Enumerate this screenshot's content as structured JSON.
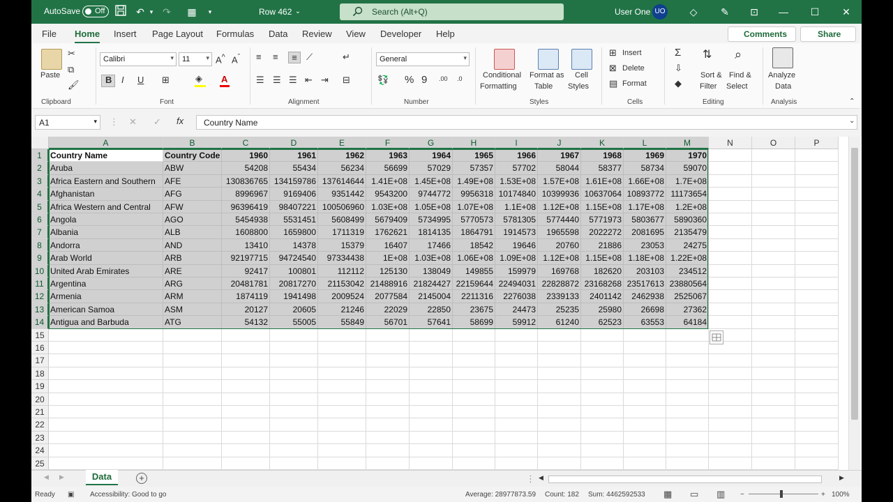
{
  "titlebar": {
    "autosave_label": "AutoSave",
    "autosave_state": "Off",
    "doc_title": "Row 462",
    "search_placeholder": "Search (Alt+Q)",
    "user_name": "User One",
    "user_initials": "UO"
  },
  "menu": {
    "tabs": [
      "File",
      "Home",
      "Insert",
      "Page Layout",
      "Formulas",
      "Data",
      "Review",
      "View",
      "Developer",
      "Help"
    ],
    "active": "Home",
    "comments": "Comments",
    "share": "Share"
  },
  "ribbon": {
    "clipboard": {
      "paste": "Paste",
      "label": "Clipboard"
    },
    "font": {
      "name": "Calibri",
      "size": "11",
      "label": "Font"
    },
    "alignment": {
      "label": "Alignment"
    },
    "number": {
      "format": "General",
      "label": "Number"
    },
    "styles": {
      "conditional1": "Conditional",
      "conditional2": "Formatting",
      "format_table1": "Format as",
      "format_table2": "Table",
      "cell_styles1": "Cell",
      "cell_styles2": "Styles",
      "label": "Styles"
    },
    "cells": {
      "insert": "Insert",
      "delete": "Delete",
      "format": "Format",
      "label": "Cells"
    },
    "editing": {
      "sort1": "Sort &",
      "sort2": "Filter",
      "find1": "Find &",
      "find2": "Select",
      "label": "Editing"
    },
    "analysis": {
      "analyze1": "Analyze",
      "analyze2": "Data",
      "label": "Analysis"
    }
  },
  "formula_bar": {
    "name_box": "A1",
    "fx": "fx",
    "content": "Country Name"
  },
  "columns": [
    "A",
    "B",
    "C",
    "D",
    "E",
    "F",
    "G",
    "H",
    "I",
    "J",
    "K",
    "L",
    "M",
    "N",
    "O",
    "P"
  ],
  "rows": [
    [
      "Country Name",
      "Country Code",
      "1960",
      "1961",
      "1962",
      "1963",
      "1964",
      "1965",
      "1966",
      "1967",
      "1968",
      "1969",
      "1970"
    ],
    [
      "Aruba",
      "ABW",
      "54208",
      "55434",
      "56234",
      "56699",
      "57029",
      "57357",
      "57702",
      "58044",
      "58377",
      "58734",
      "59070"
    ],
    [
      "Africa Eastern and Southern",
      "AFE",
      "130836765",
      "134159786",
      "137614644",
      "1.41E+08",
      "1.45E+08",
      "1.49E+08",
      "1.53E+08",
      "1.57E+08",
      "1.61E+08",
      "1.66E+08",
      "1.7E+08"
    ],
    [
      "Afghanistan",
      "AFG",
      "8996967",
      "9169406",
      "9351442",
      "9543200",
      "9744772",
      "9956318",
      "10174840",
      "10399936",
      "10637064",
      "10893772",
      "11173654"
    ],
    [
      "Africa Western and Central",
      "AFW",
      "96396419",
      "98407221",
      "100506960",
      "1.03E+08",
      "1.05E+08",
      "1.07E+08",
      "1.1E+08",
      "1.12E+08",
      "1.15E+08",
      "1.17E+08",
      "1.2E+08"
    ],
    [
      "Angola",
      "AGO",
      "5454938",
      "5531451",
      "5608499",
      "5679409",
      "5734995",
      "5770573",
      "5781305",
      "5774440",
      "5771973",
      "5803677",
      "5890360"
    ],
    [
      "Albania",
      "ALB",
      "1608800",
      "1659800",
      "1711319",
      "1762621",
      "1814135",
      "1864791",
      "1914573",
      "1965598",
      "2022272",
      "2081695",
      "2135479"
    ],
    [
      "Andorra",
      "AND",
      "13410",
      "14378",
      "15379",
      "16407",
      "17466",
      "18542",
      "19646",
      "20760",
      "21886",
      "23053",
      "24275"
    ],
    [
      "Arab World",
      "ARB",
      "92197715",
      "94724540",
      "97334438",
      "1E+08",
      "1.03E+08",
      "1.06E+08",
      "1.09E+08",
      "1.12E+08",
      "1.15E+08",
      "1.18E+08",
      "1.22E+08"
    ],
    [
      "United Arab Emirates",
      "ARE",
      "92417",
      "100801",
      "112112",
      "125130",
      "138049",
      "149855",
      "159979",
      "169768",
      "182620",
      "203103",
      "234512"
    ],
    [
      "Argentina",
      "ARG",
      "20481781",
      "20817270",
      "21153042",
      "21488916",
      "21824427",
      "22159644",
      "22494031",
      "22828872",
      "23168268",
      "23517613",
      "23880564"
    ],
    [
      "Armenia",
      "ARM",
      "1874119",
      "1941498",
      "2009524",
      "2077584",
      "2145004",
      "2211316",
      "2276038",
      "2339133",
      "2401142",
      "2462938",
      "2525067"
    ],
    [
      "American Samoa",
      "ASM",
      "20127",
      "20605",
      "21246",
      "22029",
      "22850",
      "23675",
      "24473",
      "25235",
      "25980",
      "26698",
      "27362"
    ],
    [
      "Antigua and Barbuda",
      "ATG",
      "54132",
      "55005",
      "55849",
      "56701",
      "57641",
      "58699",
      "59912",
      "61240",
      "62523",
      "63553",
      "64184"
    ]
  ],
  "row_numbers": [
    "1",
    "2",
    "3",
    "4",
    "5",
    "6",
    "7",
    "8",
    "9",
    "10",
    "11",
    "12",
    "13",
    "14",
    "15",
    "16",
    "17",
    "18",
    "19",
    "20",
    "21",
    "22",
    "23",
    "24",
    "25"
  ],
  "sheet": {
    "name": "Data"
  },
  "status": {
    "ready": "Ready",
    "accessibility": "Accessibility: Good to go",
    "average": "Average: 28977873.59",
    "count": "Count: 182",
    "sum": "Sum: 4462592533",
    "zoom": "100%"
  }
}
